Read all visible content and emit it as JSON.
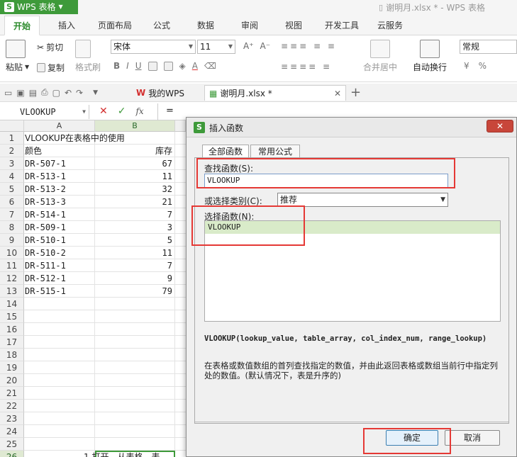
{
  "app": {
    "name": "WPS 表格",
    "window_title": "谢明月.xlsx * - WPS 表格"
  },
  "ribbon_tabs": [
    "开始",
    "插入",
    "页面布局",
    "公式",
    "数据",
    "审阅",
    "视图",
    "开发工具",
    "云服务"
  ],
  "ribbon": {
    "paste": "粘贴",
    "cut": "剪切",
    "copy": "复制",
    "format_painter": "格式刷",
    "font_name": "宋体",
    "font_size": "11",
    "merge_center": "合并居中",
    "wrap_text": "自动换行",
    "number_format": "常规",
    "percent": "%"
  },
  "doc_tabs": [
    {
      "label": "我的WPS"
    },
    {
      "label": "谢明月.xlsx *"
    }
  ],
  "formula_bar": {
    "name_box": "VLOOKUP",
    "fx": "fx",
    "content": "="
  },
  "sheet": {
    "col_headers": [
      "A",
      "B"
    ],
    "rows": [
      {
        "n": "1",
        "a": "VLOOKUP在表格中的使用",
        "b": ""
      },
      {
        "n": "2",
        "a": "颜色",
        "b": "库存"
      },
      {
        "n": "3",
        "a": "DR-507-1",
        "b": "67"
      },
      {
        "n": "4",
        "a": "DR-513-1",
        "b": "11"
      },
      {
        "n": "5",
        "a": "DR-513-2",
        "b": "32"
      },
      {
        "n": "6",
        "a": "DR-513-3",
        "b": "21"
      },
      {
        "n": "7",
        "a": "DR-514-1",
        "b": "7"
      },
      {
        "n": "8",
        "a": "DR-509-1",
        "b": "3"
      },
      {
        "n": "9",
        "a": "DR-510-1",
        "b": "5"
      },
      {
        "n": "10",
        "a": "DR-510-2",
        "b": "11"
      },
      {
        "n": "11",
        "a": "DR-511-1",
        "b": "7"
      },
      {
        "n": "12",
        "a": "DR-512-1",
        "b": "9"
      },
      {
        "n": "13",
        "a": "DR-515-1",
        "b": "79"
      },
      {
        "n": "14",
        "a": "",
        "b": ""
      },
      {
        "n": "15",
        "a": "",
        "b": ""
      },
      {
        "n": "16",
        "a": "",
        "b": ""
      },
      {
        "n": "17",
        "a": "",
        "b": ""
      },
      {
        "n": "18",
        "a": "",
        "b": ""
      },
      {
        "n": "19",
        "a": "",
        "b": ""
      },
      {
        "n": "20",
        "a": "",
        "b": ""
      },
      {
        "n": "21",
        "a": "",
        "b": ""
      },
      {
        "n": "22",
        "a": "",
        "b": ""
      },
      {
        "n": "23",
        "a": "",
        "b": ""
      },
      {
        "n": "24",
        "a": "",
        "b": ""
      },
      {
        "n": "25",
        "a": "",
        "b": ""
      },
      {
        "n": "26",
        "a": "",
        "b": "="
      }
    ],
    "bottom_partial_text": "1 打开，从表格，表"
  },
  "dialog": {
    "title": "插入函数",
    "close_label": "关闭",
    "tabs": [
      "全部函数",
      "常用公式"
    ],
    "search_label": "查找函数(S):",
    "search_value": "VLOOKUP",
    "category_label": "或选择类别(C):",
    "category_value": "推荐",
    "select_label": "选择函数(N):",
    "functions": [
      "VLOOKUP"
    ],
    "signature": "VLOOKUP(lookup_value, table_array, col_index_num, range_lookup)",
    "description": "在表格或数值数组的首列查找指定的数值，并由此返回表格或数组当前行中指定列处的数值。(默认情况下，表是升序的)",
    "ok_label": "确定",
    "cancel_label": "取消"
  },
  "colors": {
    "accent": "#3e9a3a",
    "highlight": "#e53935",
    "selection": "#d9ebc9"
  }
}
